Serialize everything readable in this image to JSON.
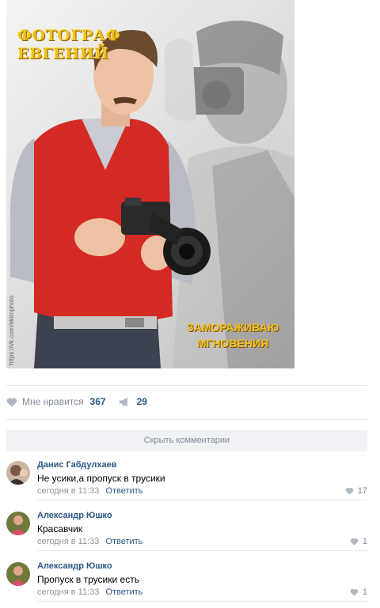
{
  "post": {
    "image_title": "ФОТОГРАФ\nЕВГЕНИЙ",
    "image_slogan": "ЗАМОРАЖИВАЮ\nМГНОВЕНИЯ",
    "image_watermark": "https://vk.com/ekimphoto"
  },
  "actions": {
    "like_label": "Мне нравится",
    "like_count": "367",
    "repost_count": "29"
  },
  "hide_comments_label": "Скрыть комментарии",
  "comments": [
    {
      "author": "Данис Габдулхаев",
      "text": "Не усики,а пропуск в трусики",
      "time": "сегодня в 11:33",
      "reply": "Ответить",
      "likes": "17"
    },
    {
      "author": "Александр Юшко",
      "text": "Красавчик",
      "time": "сегодня в 11:33",
      "reply": "Ответить",
      "likes": "1"
    },
    {
      "author": "Александр Юшко",
      "text": "Пропуск в трусики есть",
      "time": "сегодня в 11:33",
      "reply": "Ответить",
      "likes": "1"
    }
  ],
  "colors": {
    "link": "#2a5885",
    "muted": "#828a99",
    "divider": "#e7e8ec"
  },
  "icons": {
    "like": "heart-icon",
    "repost": "megaphone-icon"
  }
}
